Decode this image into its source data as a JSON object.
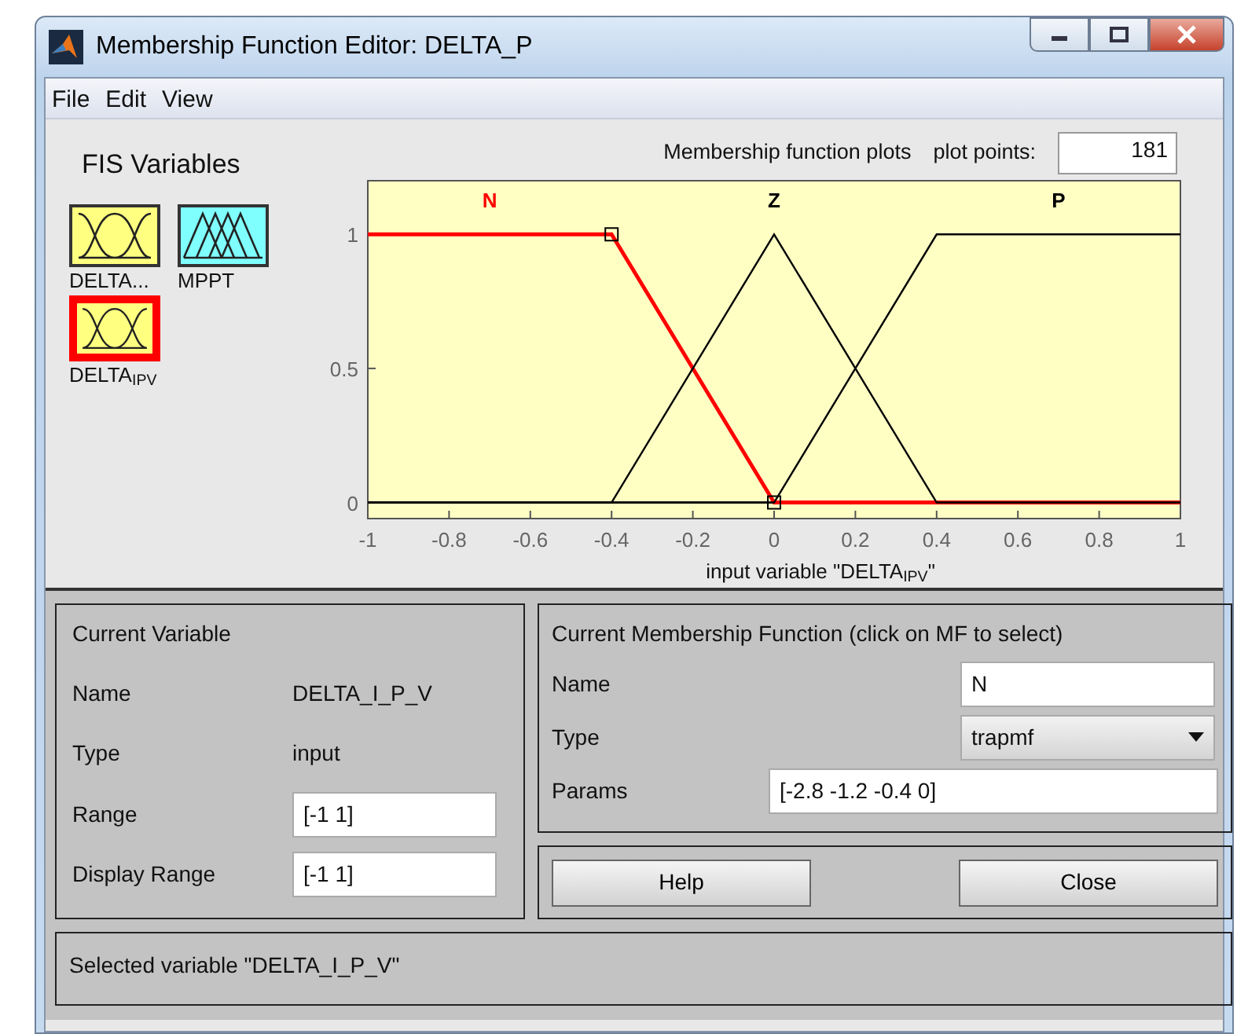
{
  "window": {
    "title": "Membership Function Editor: DELTA_P"
  },
  "menu": [
    {
      "label": "File"
    },
    {
      "label": "Edit"
    },
    {
      "label": "View"
    }
  ],
  "fis_variables": {
    "title": "FIS Variables",
    "items": [
      {
        "label": "DELTA...",
        "kind": "input",
        "selected": false
      },
      {
        "label": "MPPT",
        "kind": "output",
        "selected": false
      },
      {
        "label": "DELTA$_{IPV}$",
        "kind": "input",
        "selected": true
      }
    ]
  },
  "plot": {
    "title": "Membership function plots",
    "plot_points_label": "plot points:",
    "plot_points": "181",
    "chart_data": {
      "type": "line",
      "xlabel": "input variable \"DELTA$_{IPV}$\"",
      "x": [
        -1,
        -0.4,
        0,
        0.4,
        1
      ],
      "series": [
        {
          "name": "N",
          "color": "#ff0000",
          "values": [
            1,
            1,
            0,
            0,
            0
          ]
        },
        {
          "name": "Z",
          "color": "#000000",
          "values": [
            0,
            0,
            1,
            0,
            0
          ]
        },
        {
          "name": "P",
          "color": "#000000",
          "values": [
            0,
            0,
            0,
            1,
            1
          ]
        }
      ],
      "xlim": [
        -1,
        1
      ],
      "ylim": [
        -0.06,
        1.2
      ],
      "xticks": [
        -1,
        -0.8,
        -0.6,
        -0.4,
        -0.2,
        0,
        0.2,
        0.4,
        0.6,
        0.8,
        1
      ],
      "yticks": [
        0,
        0.5,
        1
      ]
    },
    "membership_functions": [
      {
        "selected": true
      },
      {
        "selected": false
      },
      {
        "selected": false
      }
    ]
  },
  "current_variable": {
    "title": "Current Variable",
    "fields": [
      {
        "label": "Name",
        "value": "DELTA_I_P_V",
        "kind": "text"
      },
      {
        "label": "Type",
        "value": "input",
        "kind": "text"
      },
      {
        "label": "Range",
        "value": "[-1 1]",
        "kind": "input"
      },
      {
        "label": "Display Range",
        "value": "[-1 1]",
        "kind": "input"
      }
    ]
  },
  "current_mf": {
    "title": "Current Membership Function (click on MF to select)",
    "fields": [
      {
        "label": "Name",
        "value": "N",
        "kind": "input"
      },
      {
        "label": "Type",
        "value": "trapmf",
        "kind": "select"
      },
      {
        "label": "Params",
        "value": "[-2.8 -1.2 -0.4 0]",
        "kind": "wide_input"
      }
    ]
  },
  "buttons": [
    {
      "label": "Help"
    },
    {
      "label": "Close"
    }
  ],
  "status": "Selected variable \"DELTA_I_P_V\""
}
